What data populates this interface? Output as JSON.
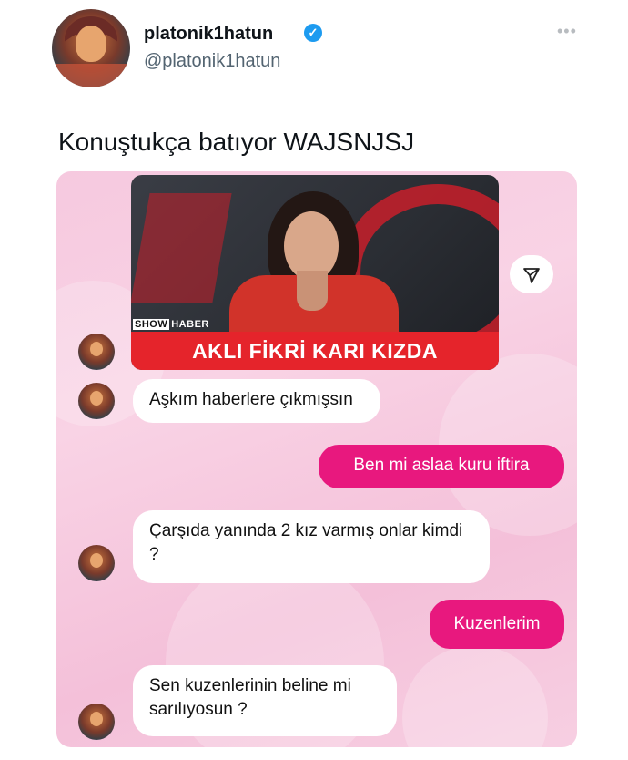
{
  "header": {
    "username": "platonik1hatun",
    "handle": "@platonik1hatun",
    "verified_icon": "verified-badge-icon",
    "more_icon": "more-options-icon"
  },
  "tweet": {
    "text": "Konuştukça batıyor WAJSNJSJ"
  },
  "news_image": {
    "brand_show": "SHOW",
    "brand_haber": "HABER",
    "headline": "AKLI FİKRİ KARI KIZDA"
  },
  "messages": [
    {
      "side": "in",
      "text": "Aşkım haberlere çıkmışsın"
    },
    {
      "side": "out",
      "text": "Ben mi aslaa kuru iftira"
    },
    {
      "side": "in",
      "text": "Çarşıda yanında 2 kız varmış onlar kimdi ?"
    },
    {
      "side": "out",
      "text": "Kuzenlerim"
    },
    {
      "side": "in",
      "text": "Sen kuzenlerinin beline mi sarılıyosun ?"
    }
  ],
  "colors": {
    "outgoing_bubble": "#e8187e",
    "incoming_bubble": "#ffffff",
    "verified": "#1d9bf0",
    "chat_background": "#f7cfe2"
  }
}
